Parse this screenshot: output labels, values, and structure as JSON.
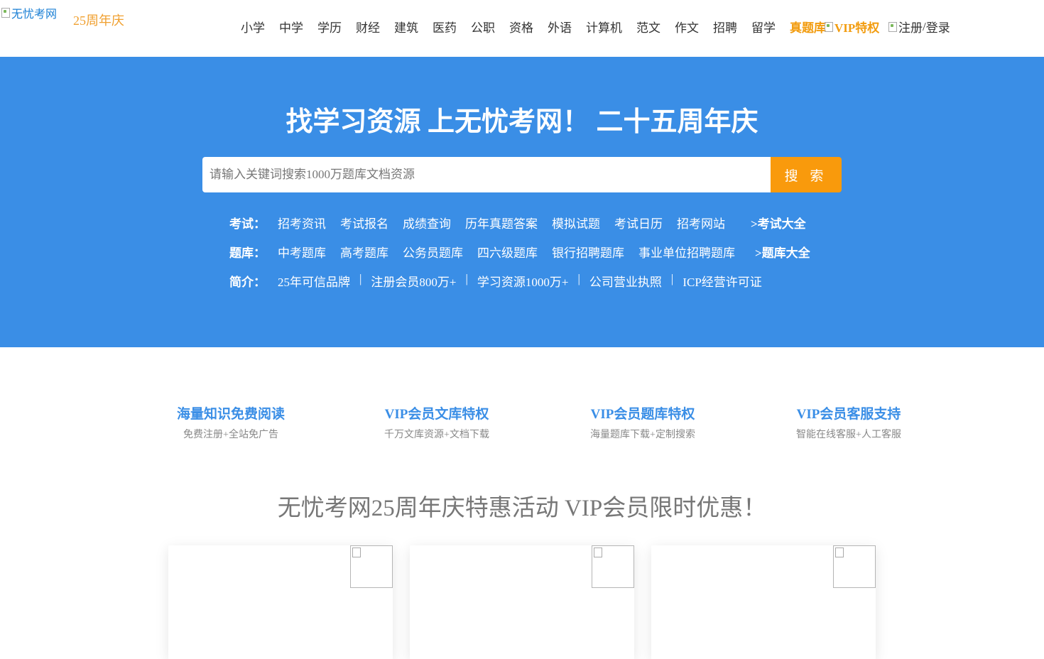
{
  "header": {
    "logo_alt": "无忧考网",
    "anniversary": "25周年庆",
    "nav": [
      "小学",
      "中学",
      "学历",
      "财经",
      "建筑",
      "医药",
      "公职",
      "资格",
      "外语",
      "计算机",
      "范文",
      "作文",
      "招聘",
      "留学",
      "真题库"
    ],
    "vip": "VIP特权",
    "register": "注册",
    "slash": "/",
    "login": "登录"
  },
  "hero": {
    "title": "找学习资源 上无忧考网！ 二十五周年庆",
    "search_placeholder": "请输入关键词搜索1000万题库文档资源",
    "search_button": "搜 索",
    "exam": {
      "label": "考试：",
      "items": [
        "招考资讯",
        "考试报名",
        "成绩查询",
        "历年真题答案",
        "模拟试题",
        "考试日历",
        "招考网站"
      ],
      "more": ">考试大全"
    },
    "bank": {
      "label": "题库：",
      "items": [
        "中考题库",
        "高考题库",
        "公务员题库",
        "四六级题库",
        "银行招聘题库",
        "事业单位招聘题库"
      ],
      "more": ">题库大全"
    },
    "intro": {
      "label": "简介：",
      "items": [
        "25年可信品牌",
        "注册会员800万+",
        "学习资源1000万+",
        "公司营业执照",
        "ICP经营许可证"
      ],
      "sep": "|"
    }
  },
  "features": [
    {
      "title": "海量知识免费阅读",
      "sub": "免费注册+全站免广告"
    },
    {
      "title": "VIP会员文库特权",
      "sub": "千万文库资源+文档下载"
    },
    {
      "title": "VIP会员题库特权",
      "sub": "海量题库下载+定制搜索"
    },
    {
      "title": "VIP会员客服支持",
      "sub": "智能在线客服+人工客服"
    }
  ],
  "promo_title": "无忧考网25周年庆特惠活动 VIP会员限时优惠！",
  "colors": {
    "brand_blue": "#3a8ee6",
    "accent_orange": "#f99a0c",
    "highlight": "#f29c0f"
  }
}
